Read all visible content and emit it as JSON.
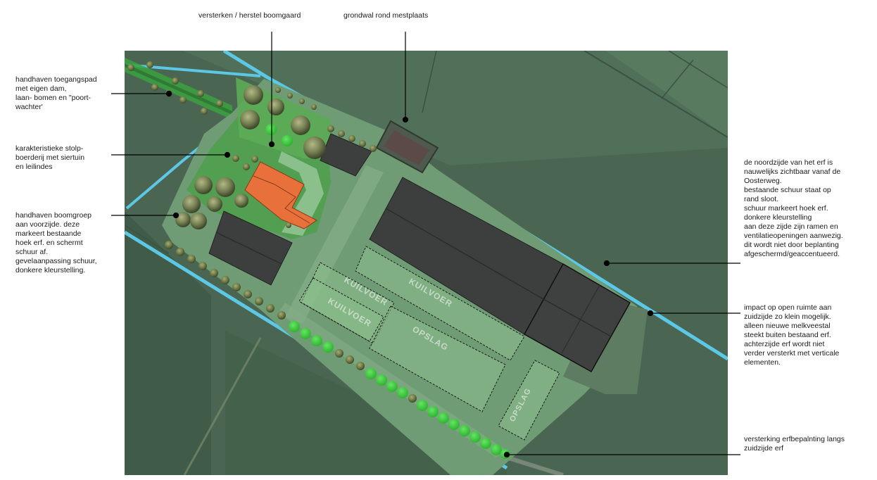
{
  "annotations": {
    "versterken_boomgaard": {
      "lines": [
        "versterken / herstel boomgaard"
      ]
    },
    "grondwal_mestplaats": {
      "lines": [
        "grondwal rond mestplaats"
      ]
    },
    "toegangspad": {
      "lines": [
        "handhaven toegangspad",
        "met eigen dam,",
        "laan- bomen en \"poort-",
        "wachter'"
      ]
    },
    "stolpboerderij": {
      "lines": [
        "karakteristieke stolp-",
        "boerderij met siertuin",
        "en leilindes"
      ]
    },
    "boomgroep": {
      "lines": [
        "handhaven boomgroep",
        "aan voorzijde. deze",
        "markeert bestaande",
        "hoek erf. en schermt",
        "schuur af.",
        "gevelaanpassing schuur,",
        "donkere kleurstelling."
      ]
    },
    "noordzijde": {
      "lines": [
        "de noordzijde van het erf is",
        "nauwelijks zichtbaar vanaf de",
        "Oosterweg.",
        "bestaande schuur staat op",
        "rand sloot.",
        "schuur markeert hoek erf.",
        "donkere kleurstelling",
        "aan deze zijde zijn ramen en",
        "ventilatieopeningen aanwezig.",
        "dit wordt niet door beplanting",
        "afgeschermd/geaccentueerd."
      ]
    },
    "zuidzijde": {
      "lines": [
        "impact op open ruimte aan",
        "zuidzijde zo klein mogelijk.",
        "alleen nieuwe melkveestal",
        "steekt buiten bestaand erf.",
        "achterzijde erf wordt niet",
        "verder versterkt met verticale",
        "elementen."
      ]
    },
    "erfbeplanting": {
      "lines": [
        "versterking erfbepalnting langs",
        "zuidzijde erf"
      ]
    }
  },
  "zones": {
    "kuilvoer_1": "KUILVOER",
    "kuilvoer_2": "KUILVOER",
    "kuilvoer_3": "KUILVOER",
    "opslag_1": "OPSLAG",
    "opslag_2": "OPSLAG"
  },
  "colors": {
    "field": "#4a6652",
    "field_dark": "#3d5a47",
    "yard": "#6f9c75",
    "yard_light": "#85b285",
    "garden": "#4fa04f",
    "water": "#5cc8e6",
    "barn": "#3d3f3e",
    "farmhouse": "#e8703a",
    "new_trees": "#3fcc3f",
    "existing_trees": "#6f7a48",
    "leader": "#000000"
  }
}
